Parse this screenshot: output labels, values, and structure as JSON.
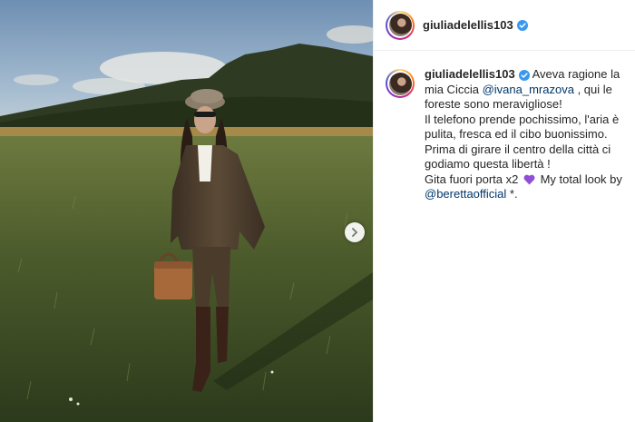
{
  "post": {
    "username": "giuliadelellis103",
    "verified": true,
    "caption": {
      "p1": "Aveva ragione la mia Ciccia",
      "mention1": "@ivana_mrazova",
      "p2": ", qui le foreste sono meravigliose!",
      "p3": "Il telefono prende pochissimo, l'aria è pulita, fresca ed il cibo buonissimo.",
      "p4": "Prima di girare il centro della città ci godiamo questa libertà !",
      "p5": "Gita fuori porta x2",
      "p6": "My total look by",
      "mention2": "@berettaofficial",
      "p7": "*."
    },
    "icons": {
      "verified": "verified-badge-icon",
      "next": "chevron-right-icon",
      "heart": "purple-heart-icon"
    }
  },
  "colors": {
    "verified_blue": "#3897f0",
    "mention": "#00376b",
    "heart": "#8f4fd8"
  }
}
